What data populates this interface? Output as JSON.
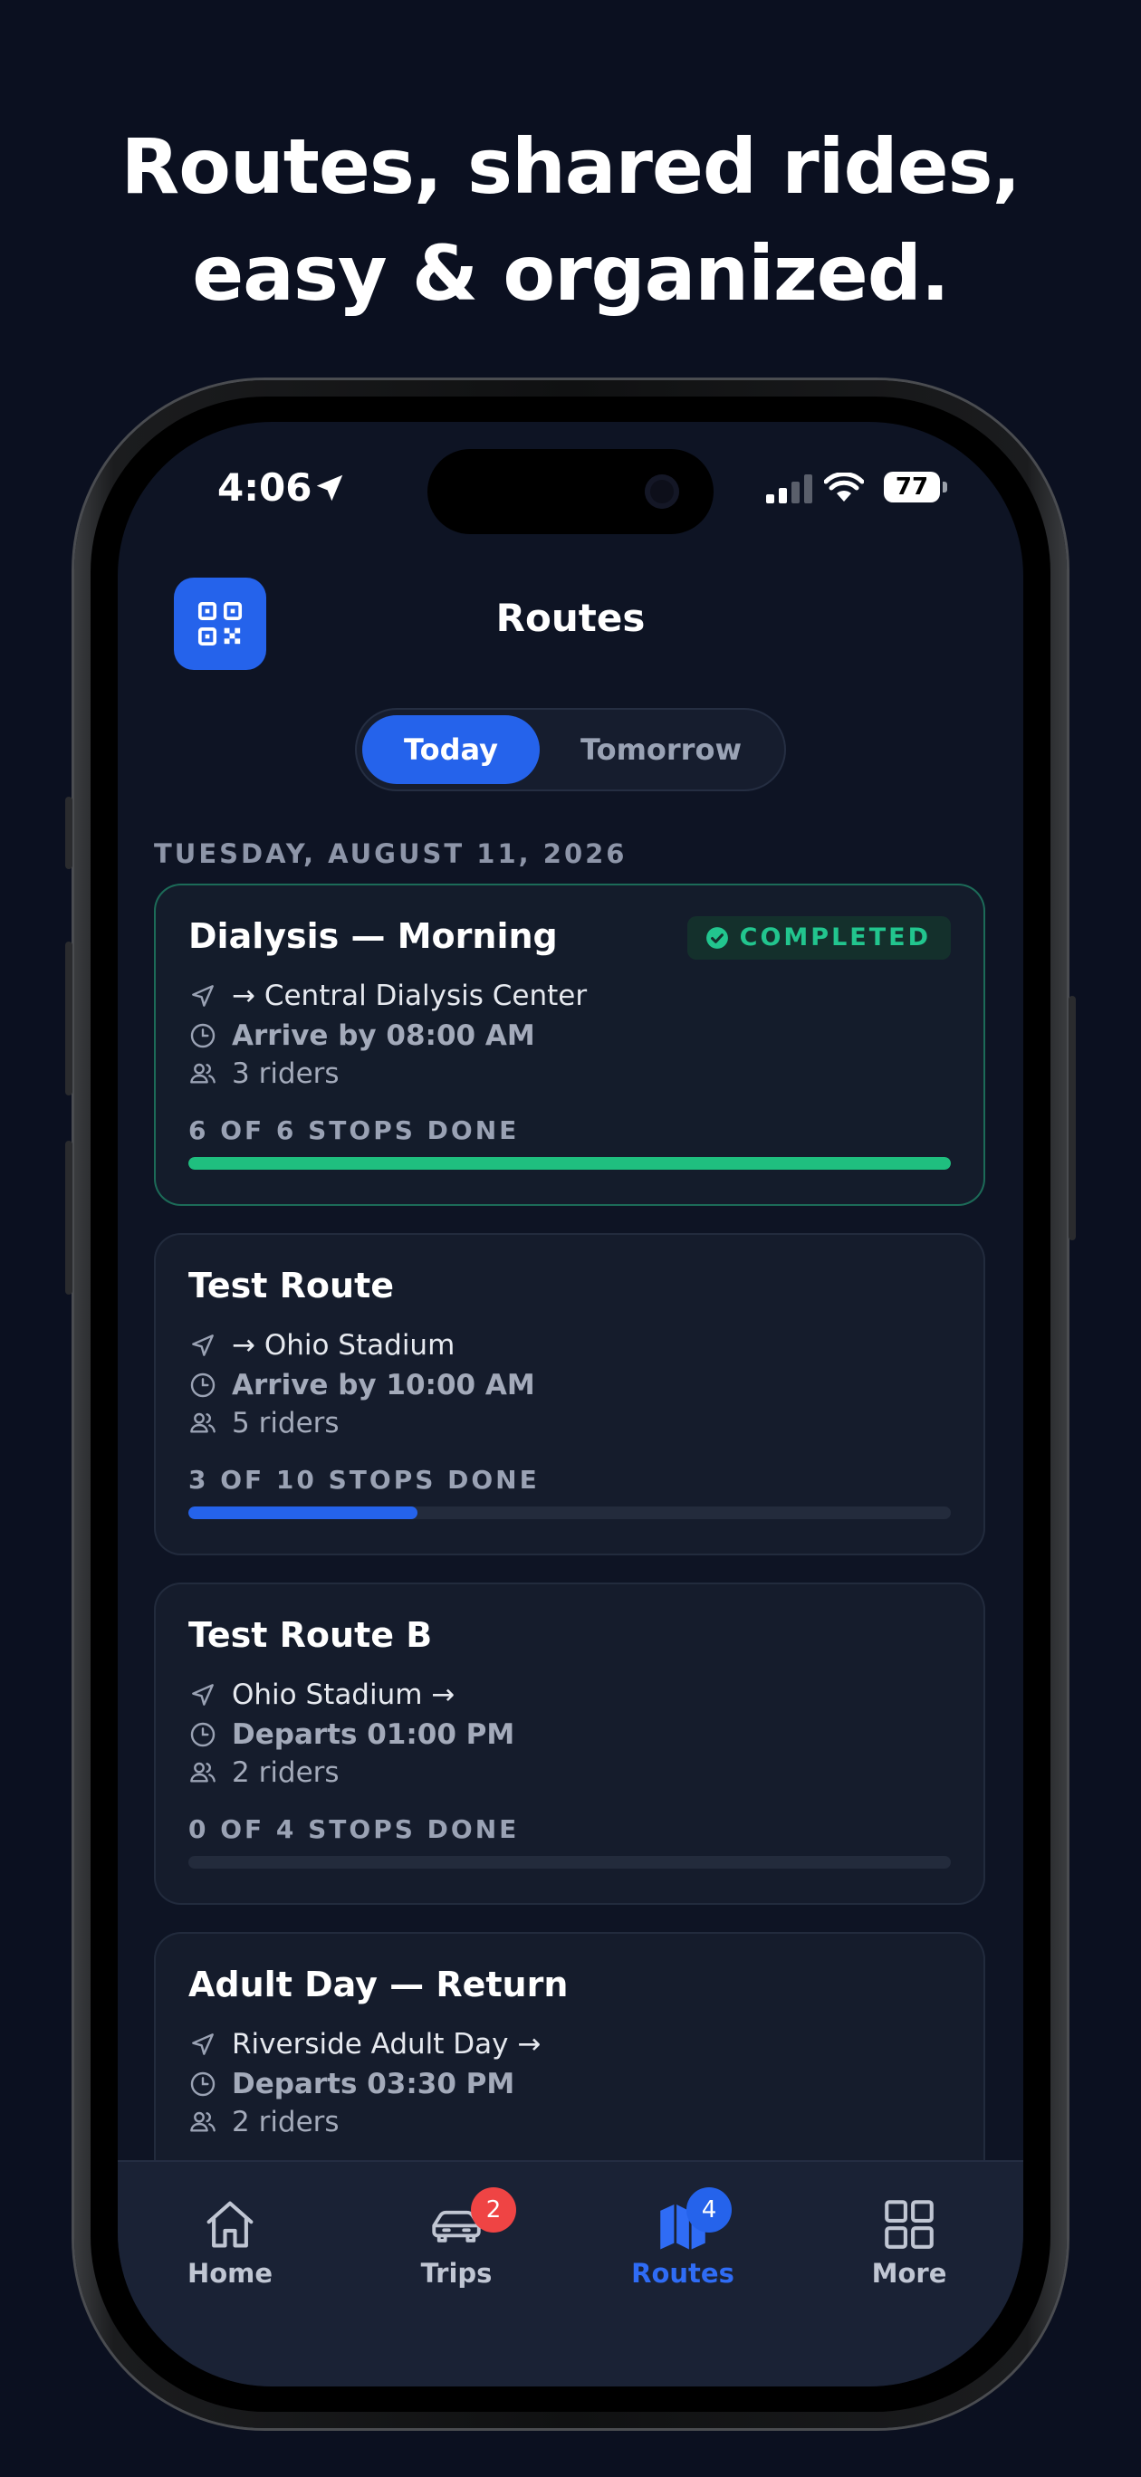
{
  "headline": {
    "line1": "Routes, shared rides,",
    "line2": "easy & organized."
  },
  "status_bar": {
    "time": "4:06",
    "battery": "77"
  },
  "header": {
    "title": "Routes"
  },
  "segment": {
    "today": "Today",
    "tomorrow": "Tomorrow",
    "selected": "Today"
  },
  "date_label": "TUESDAY, AUGUST 11, 2026",
  "routes": [
    {
      "title": "Dialysis — Morning",
      "badge": "COMPLETED",
      "destination": "→ Central Dialysis Center",
      "time": "Arrive by 08:00 AM",
      "riders": "3 riders",
      "stops": "6 OF 6 STOPS DONE",
      "progress": 1.0,
      "color": "#1fbf7f"
    },
    {
      "title": "Test Route",
      "destination": "→ Ohio Stadium",
      "time": "Arrive by 10:00 AM",
      "riders": "5 riders",
      "stops": "3 OF 10 STOPS DONE",
      "progress": 0.3,
      "color": "#2563eb"
    },
    {
      "title": "Test Route B",
      "destination": "Ohio Stadium →",
      "time": "Departs 01:00 PM",
      "riders": "2 riders",
      "stops": "0 OF 4 STOPS DONE",
      "progress": 0.0,
      "color": "#2563eb"
    },
    {
      "title": "Adult Day — Return",
      "destination": "Riverside Adult Day →",
      "time": "Departs 03:30 PM",
      "riders": "2 riders"
    }
  ],
  "tabbar": {
    "items": [
      {
        "label": "Home",
        "icon": "home-icon"
      },
      {
        "label": "Trips",
        "icon": "car-icon",
        "badge": "2",
        "badge_color": "#ef4444"
      },
      {
        "label": "Routes",
        "icon": "map-icon",
        "badge": "4",
        "badge_color": "#2563eb",
        "active": true
      },
      {
        "label": "More",
        "icon": "grid-icon"
      }
    ]
  },
  "colors": {
    "accent": "#2563eb",
    "success": "#22c58e",
    "background": "#0e1424"
  }
}
